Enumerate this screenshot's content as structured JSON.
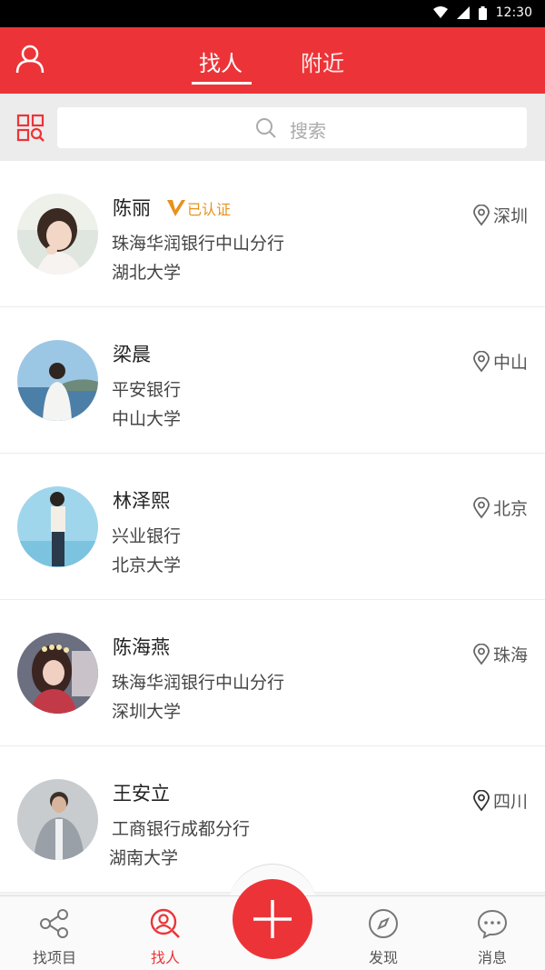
{
  "status_bar": {
    "time": "12:30"
  },
  "header": {
    "tabs": [
      {
        "label": "找人",
        "active": true
      },
      {
        "label": "附近",
        "active": false
      }
    ],
    "accent_color": "#ec3438"
  },
  "search": {
    "placeholder": "搜索"
  },
  "people": [
    {
      "name": "陈丽",
      "verified_label": "已认证",
      "company": "珠海华润银行中山分行",
      "school": "湖北大学",
      "location": "深圳"
    },
    {
      "name": "梁晨",
      "company": "平安银行",
      "school": "中山大学",
      "location": "中山"
    },
    {
      "name": "林泽熙",
      "company": "兴业银行",
      "school": "北京大学",
      "location": "北京"
    },
    {
      "name": "陈海燕",
      "company": "珠海华润银行中山分行",
      "school": "深圳大学",
      "location": "珠海"
    },
    {
      "name": "王安立",
      "company": "工商银行成都分行",
      "school": "湖南大学",
      "location": "四川"
    }
  ],
  "tabbar": {
    "items": [
      {
        "label": "找项目",
        "icon": "network-icon"
      },
      {
        "label": "找人",
        "icon": "find-person-icon",
        "active": true
      },
      {
        "label": "",
        "icon": "plus-icon"
      },
      {
        "label": "发现",
        "icon": "compass-icon"
      },
      {
        "label": "消息",
        "icon": "chat-bubble-icon"
      }
    ]
  }
}
